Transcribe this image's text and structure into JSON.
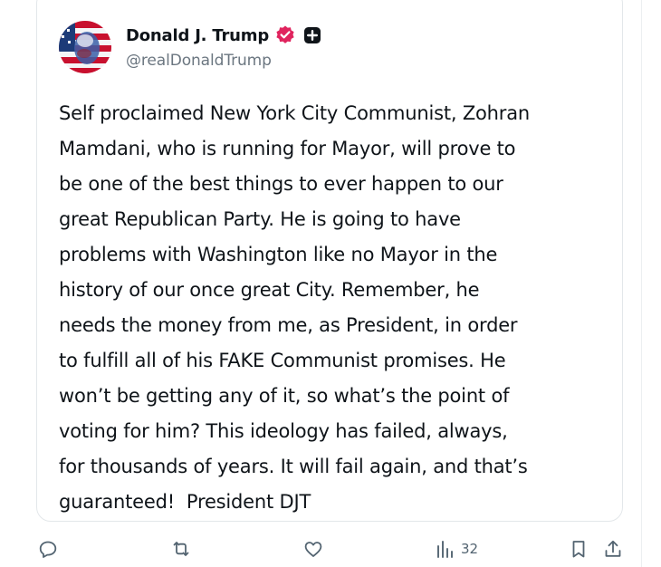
{
  "author": {
    "display_name": "Donald J. Trump",
    "handle": "@realDonaldTrump",
    "verified_badge_color": "#e0245e",
    "badge_icon": "plus-square-icon"
  },
  "post": {
    "lines": [
      "Self proclaimed New York City Communist, Zohran",
      "Mamdani, who is running for Mayor, will prove to",
      "be one of the best things to ever happen to our",
      "great Republican Party. He is going to have",
      "problems with Washington like no Mayor in the",
      "history of our once great City. Remember, he",
      "needs the money from me, as President, in order",
      "to fulfill all of his FAKE Communist promises. He",
      "won’t be getting any of it, so what’s the point of",
      "voting for him? This ideology has failed, always,",
      "for thousands of years. It will fail again, and that’s",
      "guaranteed!  President DJT"
    ]
  },
  "actions": {
    "reply_icon": "reply-icon",
    "repost_icon": "repost-icon",
    "like_icon": "heart-icon",
    "views_icon": "views-icon",
    "views_count": "32",
    "bookmark_icon": "bookmark-icon",
    "share_icon": "share-icon",
    "icon_color": "#536471"
  }
}
